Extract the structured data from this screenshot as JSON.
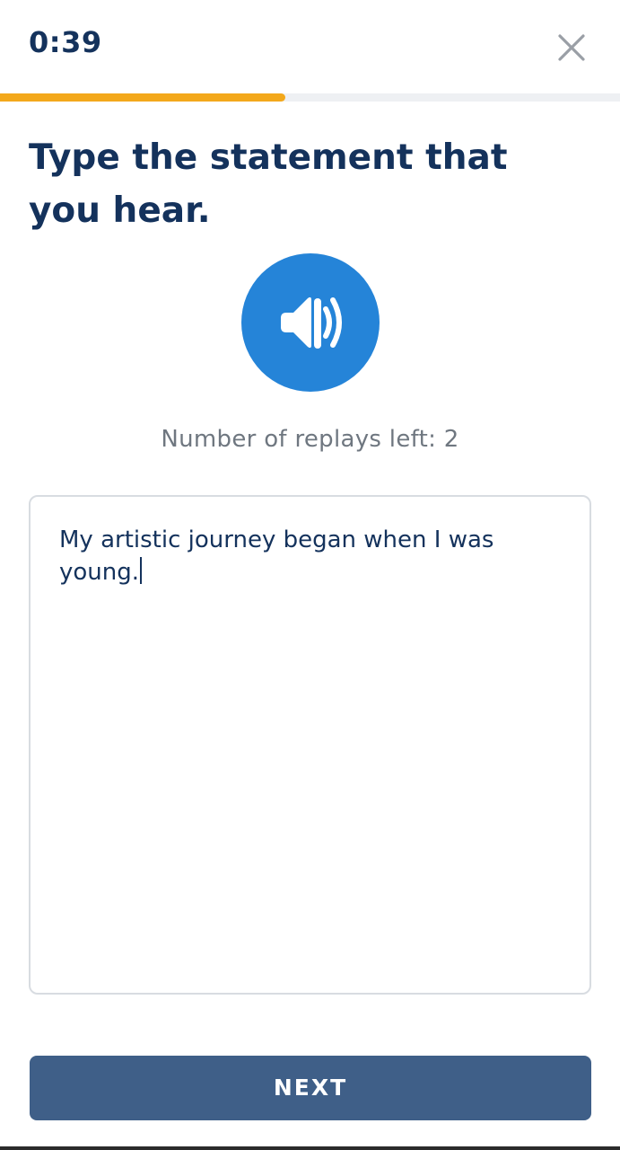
{
  "header": {
    "timer": "0:39",
    "close_icon": "close-icon"
  },
  "progress": {
    "fraction": 0.46,
    "fill_color": "#f3a81b",
    "track_color": "#eef0f3"
  },
  "prompt": {
    "title": "Type the statement that you hear."
  },
  "audio": {
    "icon": "speaker-icon",
    "color": "#2584d8",
    "replays_text": "Number of replays left: 2"
  },
  "answer": {
    "value": "My artistic journey began when I was young."
  },
  "footer": {
    "next_label": "NEXT",
    "next_color": "#3f5f88"
  }
}
